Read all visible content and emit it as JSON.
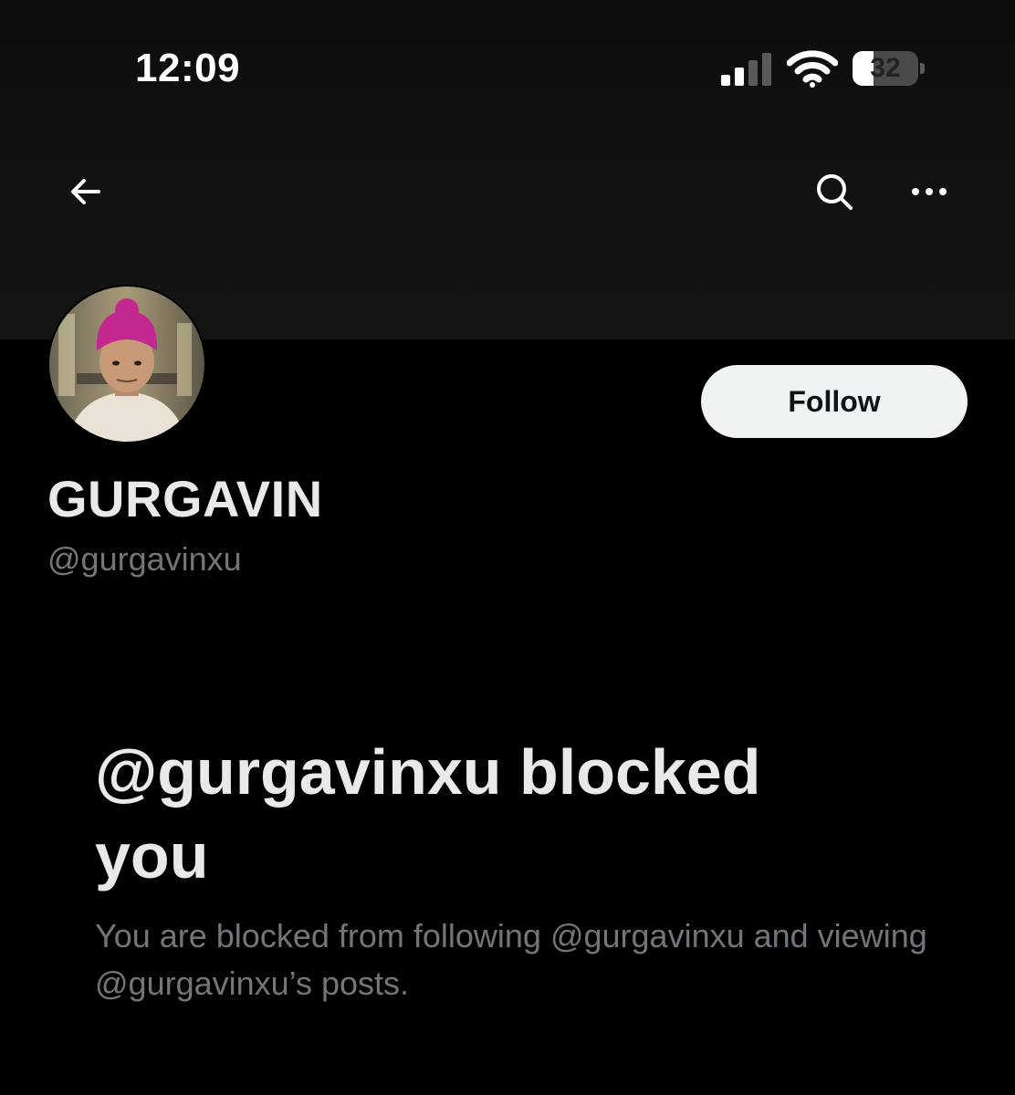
{
  "status_bar": {
    "time": "12:09",
    "battery_level": "32",
    "battery_fraction": 0.32,
    "signal_bars_active": 2,
    "signal_bars_total": 4,
    "icons": [
      "cellular-signal-icon",
      "wifi-icon",
      "battery-icon"
    ]
  },
  "nav": {
    "back_icon": "arrow-left-icon",
    "search_icon": "search-icon",
    "more_icon": "more-horizontal-icon"
  },
  "profile": {
    "display_name": "GURGAVIN",
    "handle": "@gurgavinxu",
    "follow_label": "Follow"
  },
  "blocked": {
    "title": "@gurgavinxu blocked you",
    "description": "You are blocked from following @gurgavinxu and viewing @gurgavinxu’s posts."
  },
  "colors": {
    "background": "#000000",
    "primary_text": "#e7e9ea",
    "secondary_text": "#71767b",
    "follow_button_bg": "#eff3f4",
    "avatar_turban": "#c2288f"
  }
}
